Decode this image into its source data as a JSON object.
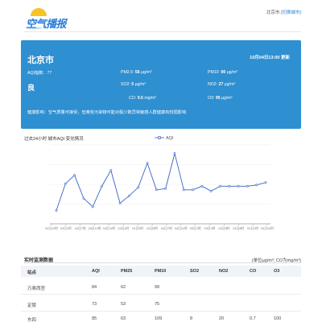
{
  "header": {
    "logo_text": "空气播报",
    "logo_sub": "KQ BOBAO",
    "current_city": "北京市",
    "switch_label": "[切换城市]"
  },
  "card": {
    "city": "北京市",
    "update_time": "10月04日13:00 更新",
    "level": "良",
    "aqi": {
      "label": "AQI指数：",
      "value": "77"
    },
    "pm25": {
      "label": "PM2.5:",
      "value": "56",
      "unit": "μg/m³"
    },
    "pm10": {
      "label": "PM10:",
      "value": "90",
      "unit": "μg/m³"
    },
    "so2": {
      "label": "SO2:",
      "value": "5",
      "unit": "μg/m³"
    },
    "no2": {
      "label": "NO2:",
      "value": "27",
      "unit": "μg/m³"
    },
    "co": {
      "label": "CO:",
      "value": "0.5",
      "unit": "mg/m³"
    },
    "o3": {
      "label": "O3:",
      "value": "95",
      "unit": "μg/m³"
    },
    "health": "健康影响：空气质量可接受，但某些污染物可能对极少数异常敏感人群健康有较弱影响"
  },
  "chart_title": "过去24小时 城市AQI 变化情况",
  "chart_data": {
    "type": "line",
    "series": [
      {
        "name": "AQI",
        "values": [
          31,
          53,
          60,
          41,
          34,
          51,
          64,
          37,
          43,
          50,
          70,
          48,
          49,
          78,
          48,
          48,
          51,
          47,
          51,
          51,
          51,
          51,
          52,
          54
        ]
      }
    ],
    "tick_labels": [
      "03日19时",
      "04日1时",
      "04日7时",
      "04日10时",
      "04日11时",
      "04日1时",
      "04日3时",
      "04日5时",
      "04日7时",
      "04日11时",
      "04日2时",
      "04日3时",
      "04日5时",
      "04日8时",
      "04日1时",
      "04日10时"
    ],
    "ylim": [
      20,
      85
    ],
    "grid": true,
    "legend": "top-center",
    "color": "#3a63c9"
  },
  "table": {
    "title": "实时监测数据",
    "unit_note": "(单位μg/m³; CO为mg/m³)",
    "headers": [
      "站点",
      "AQI",
      "PM25",
      "PM10",
      "SO2",
      "NO2",
      "CO",
      "O3"
    ],
    "rows": [
      [
        "万寿西宫",
        "84",
        "62",
        "99",
        "",
        "",
        "",
        ""
      ],
      [
        "定陵",
        "73",
        "53",
        "75",
        "",
        "",
        "",
        ""
      ],
      [
        "东四",
        "85",
        "63",
        "109",
        "8",
        "20",
        "0.7",
        "100"
      ]
    ]
  }
}
